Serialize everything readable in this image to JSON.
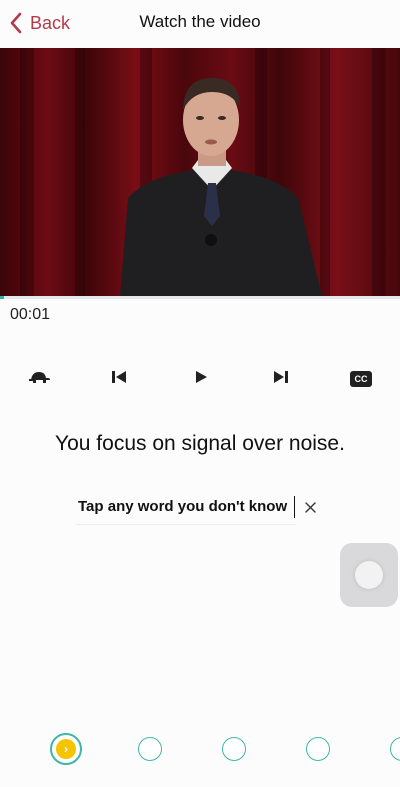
{
  "header": {
    "back_label": "Back",
    "title": "Watch the video"
  },
  "video": {
    "progress": 0.01,
    "time": "00:01"
  },
  "controls": {
    "items": [
      "turtle-icon",
      "previous-icon",
      "play-icon",
      "next-icon",
      "captions-icon"
    ],
    "cc_label": "CC"
  },
  "sentence": "You focus on signal over noise.",
  "hint": "Tap any word you don't know",
  "pagination": {
    "active_arrow": "›"
  },
  "colors": {
    "accent": "#b33a4a",
    "teal": "#3fb6a8",
    "active_dot": "#f5c400"
  }
}
